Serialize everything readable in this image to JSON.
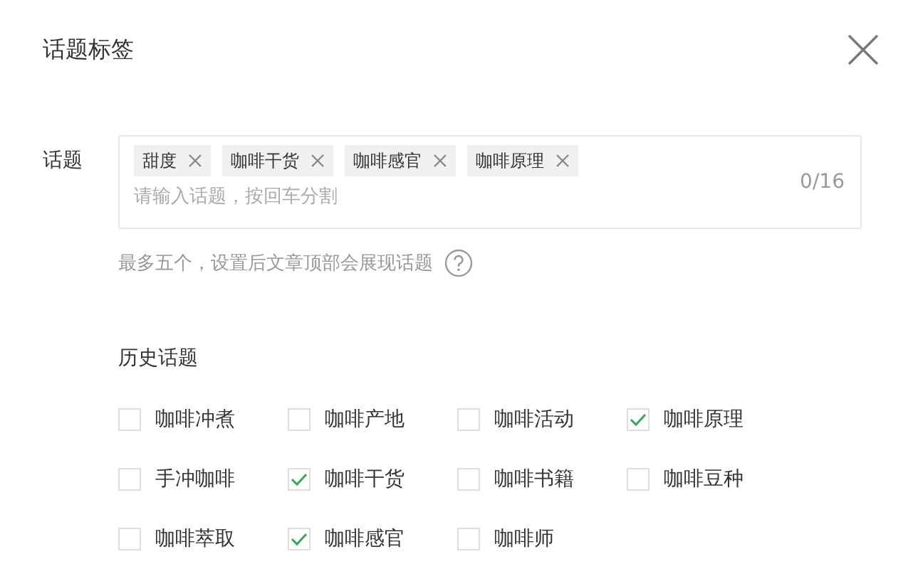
{
  "dialog": {
    "title": "话题标签"
  },
  "topic_field": {
    "label": "话题",
    "tags": [
      "甜度",
      "咖啡干货",
      "咖啡感官",
      "咖啡原理"
    ],
    "placeholder": "请输入话题，按回车分割",
    "counter": "0/16",
    "hint": "最多五个，设置后文章顶部会展现话题"
  },
  "history": {
    "title": "历史话题",
    "items": [
      {
        "label": "咖啡冲煮",
        "checked": false
      },
      {
        "label": "咖啡产地",
        "checked": false
      },
      {
        "label": "咖啡活动",
        "checked": false
      },
      {
        "label": "咖啡原理",
        "checked": true
      },
      {
        "label": "手冲咖啡",
        "checked": false
      },
      {
        "label": "咖啡干货",
        "checked": true
      },
      {
        "label": "咖啡书籍",
        "checked": false
      },
      {
        "label": "咖啡豆种",
        "checked": false
      },
      {
        "label": "咖啡萃取",
        "checked": false
      },
      {
        "label": "咖啡感官",
        "checked": true
      },
      {
        "label": "咖啡师",
        "checked": false
      }
    ]
  }
}
